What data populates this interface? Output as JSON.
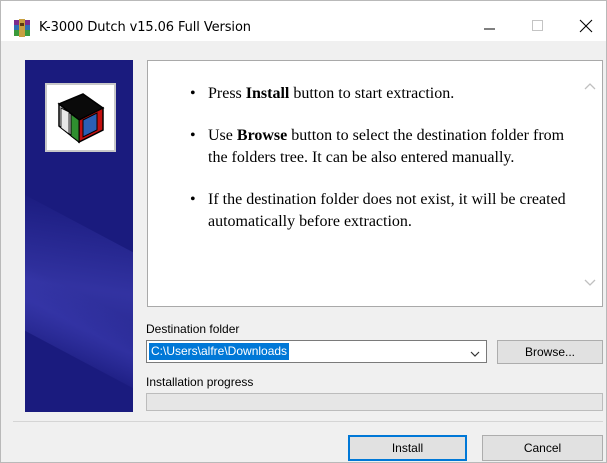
{
  "window": {
    "title": "K-3000 Dutch v15.06 Full Version"
  },
  "titlebar_buttons": {
    "minimize_icon": "minimize-icon",
    "maximize_icon": "maximize-icon",
    "close_icon": "close-icon"
  },
  "instructions": [
    {
      "before": "Press ",
      "bold": "Install",
      "after": " button to start extraction."
    },
    {
      "before": "Use ",
      "bold": "Browse",
      "after": " button to select the destination folder from the folders tree. It can be also entered manually."
    },
    {
      "before": "If the destination folder does not exist, it will be created automatically before extraction.",
      "bold": "",
      "after": ""
    }
  ],
  "bullet": "•",
  "destination": {
    "label": "Destination folder",
    "value": "C:\\Users\\alfre\\Downloads"
  },
  "browse_label": "Browse...",
  "progress": {
    "label": "Installation progress",
    "fraction": 0
  },
  "buttons": {
    "install": "Install",
    "cancel": "Cancel"
  },
  "colors": {
    "banner": "#1a1b7e",
    "selection": "#0078d7",
    "default_button_border": "#0078d7"
  }
}
